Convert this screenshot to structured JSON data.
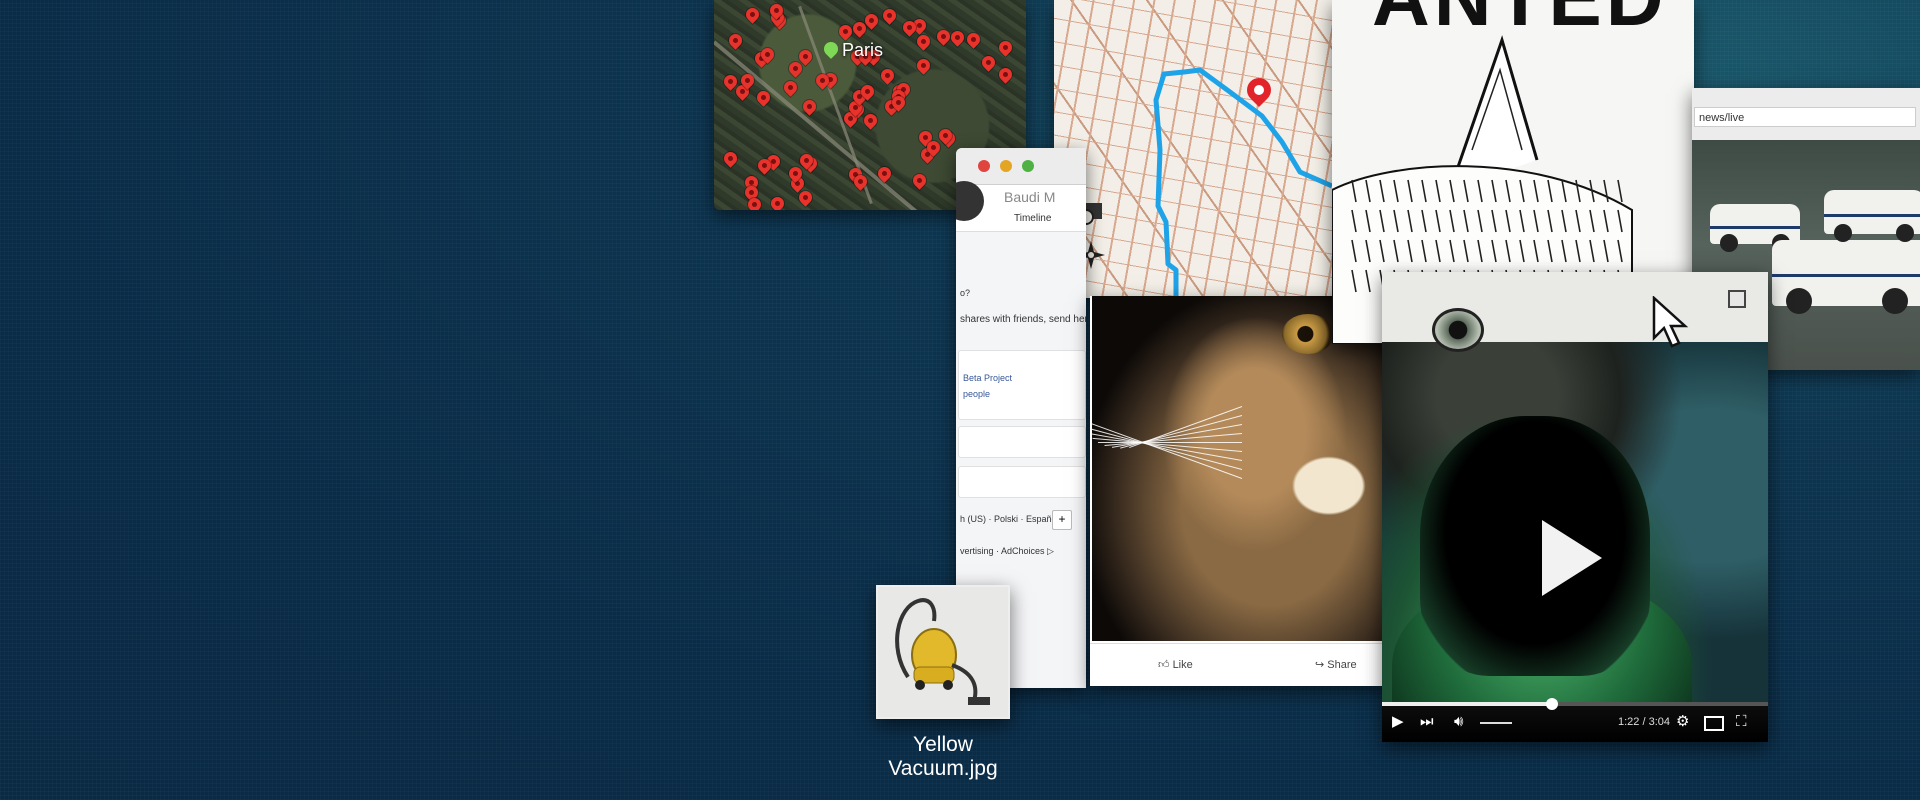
{
  "satellite_map": {
    "city_label": "Paris"
  },
  "facebook": {
    "profile_name": "Baudi M",
    "tab_timeline": "Timeline",
    "question_stub": "o?",
    "share_prompt": "shares with friends, send her a fr",
    "card_beta": "Beta Project",
    "card_people": "people",
    "languages": "h (US) · Polski · Español",
    "footer": "vertising · AdChoices ▷",
    "plus_label": "+"
  },
  "desktop_icon": {
    "line1": "Yellow",
    "line2": "Vacuum.jpg"
  },
  "post": {
    "like_label": "Like",
    "share_label": "Share"
  },
  "wanted": {
    "headline": "ANTED"
  },
  "news": {
    "url_fragment": "news/live"
  },
  "video": {
    "time": "1:22 / 3:04",
    "progress": 0.44
  },
  "icons": {
    "pin": "map-pin-icon",
    "search": "map-search-icon",
    "compass": "compass-icon",
    "play": "play-icon",
    "cursor": "pointer-cursor-icon"
  },
  "colors": {
    "background": "#0a2c47",
    "route": "#1fa3e8",
    "pin": "#e8322c",
    "paris_pin": "#7ed957"
  }
}
